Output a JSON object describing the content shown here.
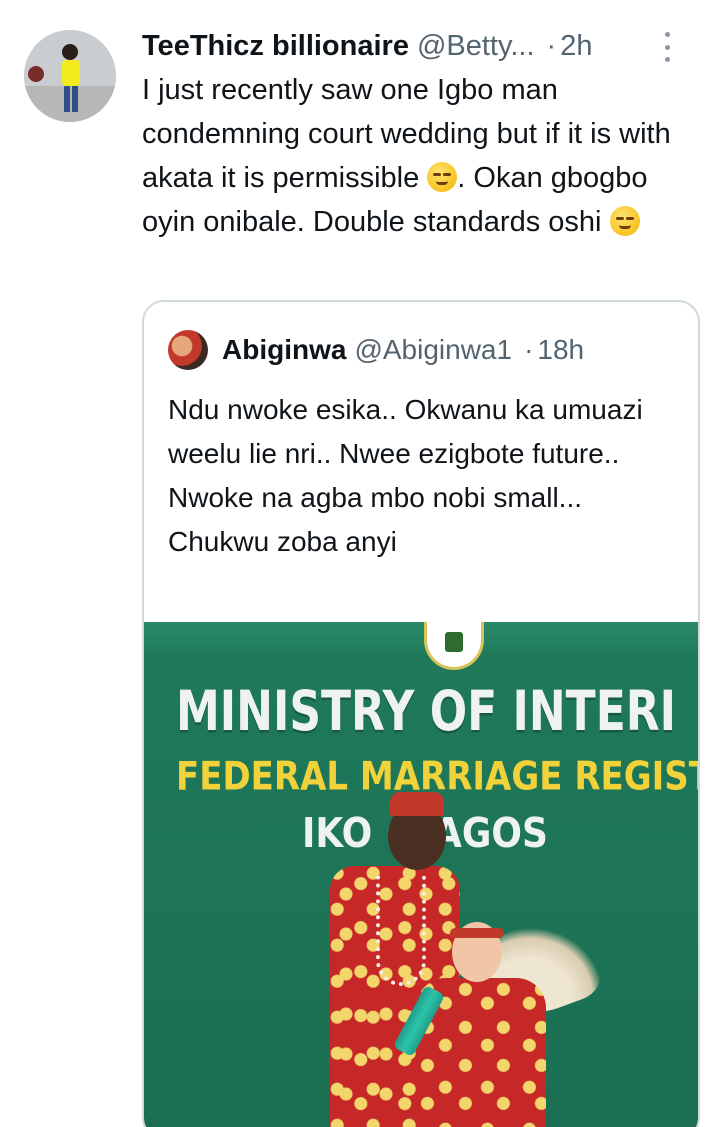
{
  "tweet": {
    "display_name": "TeeThicz billionaire",
    "handle": "@Betty...",
    "separator": "·",
    "time": "2h",
    "text_segments": [
      "I just recently saw one Igbo man condemning court wedding but if it is with akata it is permissible ",
      ". Okan gbogbo oyin onibale. Double standards oshi "
    ],
    "emojis": [
      "relieved-face-emoji",
      "smirking-face-emoji"
    ],
    "avatar": "user-avatar-photo"
  },
  "quoted_tweet": {
    "display_name": "Abiginwa",
    "handle": "@Abiginwa1",
    "separator": "·",
    "time": "18h",
    "text": "Ndu nwoke esika.. Okwanu ka umuazi weelu lie nri.. Nwee ezigbote future.. Nwoke na agba mbo nobi small... Chukwu zoba anyi",
    "avatar": "quoted-user-avatar"
  },
  "media": {
    "description_icon": "photo",
    "sign_line_1": "MINISTRY OF INTERI",
    "sign_line_2": "FEDERAL MARRIAGE REGIST",
    "sign_line_3": "IKO  · LAGOS",
    "colors": {
      "wall": "#1f7a5a",
      "sign_white": "#eef2f0",
      "sign_yellow": "#f1d23a",
      "attire_red": "#c62828"
    }
  },
  "colors": {
    "text": "#0f1419",
    "secondary": "#536471",
    "border": "#cfd9de"
  }
}
